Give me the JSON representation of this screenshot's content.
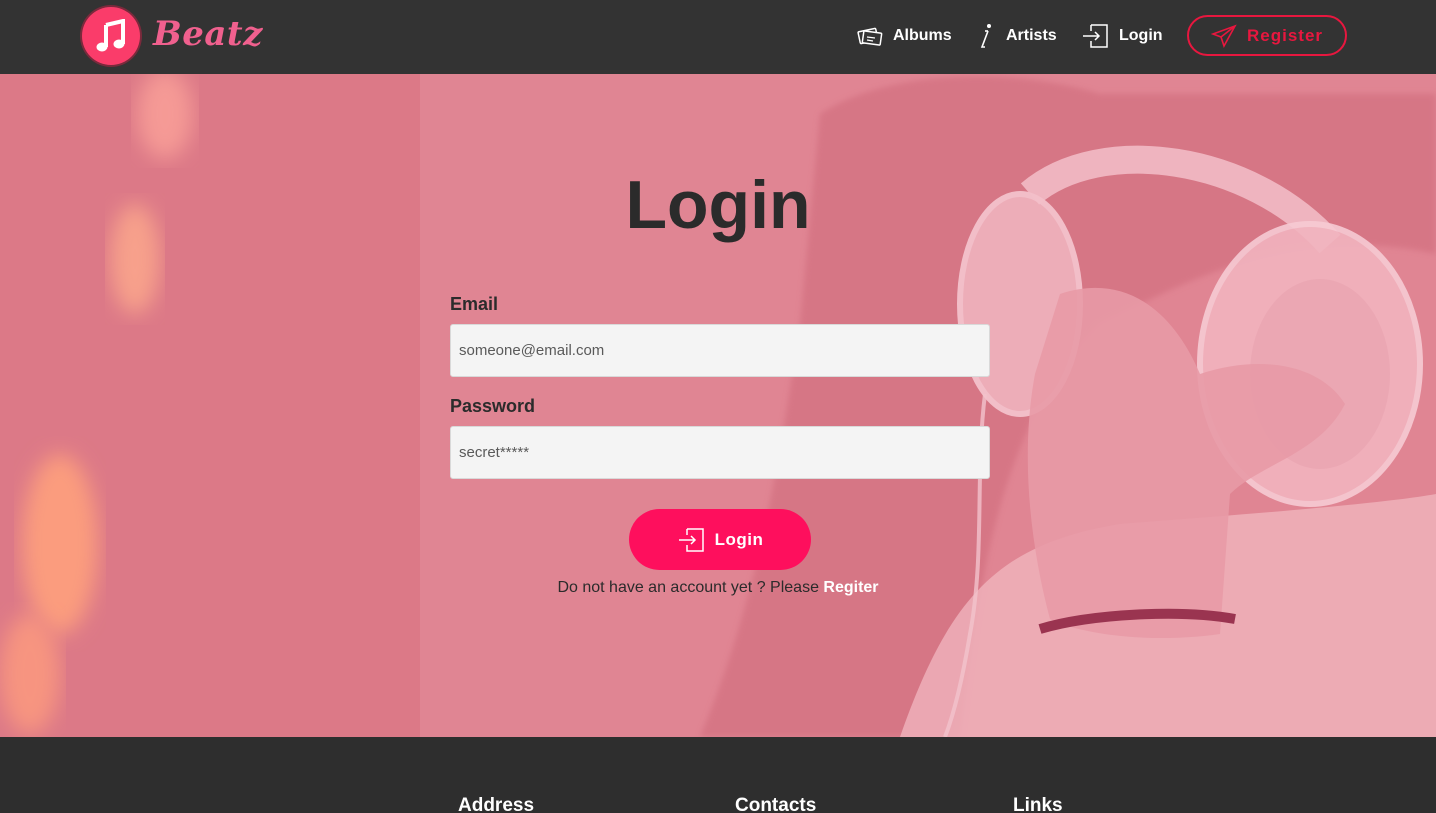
{
  "brand": {
    "name": "Beatz",
    "logo_icon": "music-note-icon",
    "accent": "#fe0f5d"
  },
  "nav": {
    "albums_label": "Albums",
    "artists_label": "Artists",
    "login_label": "Login",
    "register_label": "Register"
  },
  "login_form": {
    "title": "Login",
    "email_label": "Email",
    "email_placeholder": "someone@email.com",
    "password_label": "Password",
    "password_placeholder": "secret*****",
    "submit_label": "Login",
    "signup_prompt": "Do not have an account yet ? Please ",
    "signup_link": "Regiter"
  },
  "footer": {
    "address_heading": "Address",
    "contacts_heading": "Contacts",
    "links_heading": "Links"
  }
}
